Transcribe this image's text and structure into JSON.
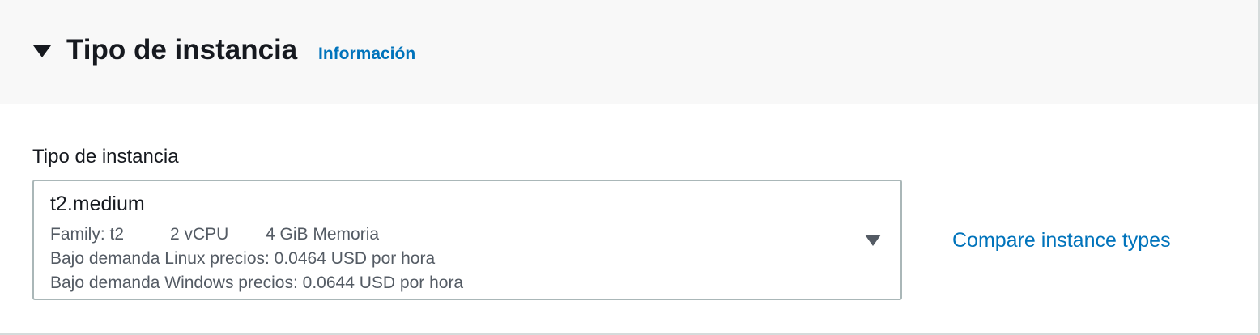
{
  "section": {
    "title": "Tipo de instancia",
    "info_link": "Información"
  },
  "field": {
    "label": "Tipo de instancia",
    "selected": {
      "name": "t2.medium",
      "family": "Family: t2",
      "vcpu": "2 vCPU",
      "memory": "4 GiB Memoria",
      "linux_price": "Bajo demanda Linux precios: 0.0464 USD por hora",
      "windows_price": "Bajo demanda Windows precios: 0.0644 USD por hora"
    }
  },
  "compare_link": "Compare instance types",
  "icons": {
    "collapse": "caret-down-icon",
    "dropdown": "caret-down-icon"
  },
  "colors": {
    "link": "#0073bb",
    "header_bg": "#f8f8f8",
    "text": "#16191f",
    "secondary_text": "#545b64",
    "border": "#aab7b8"
  }
}
